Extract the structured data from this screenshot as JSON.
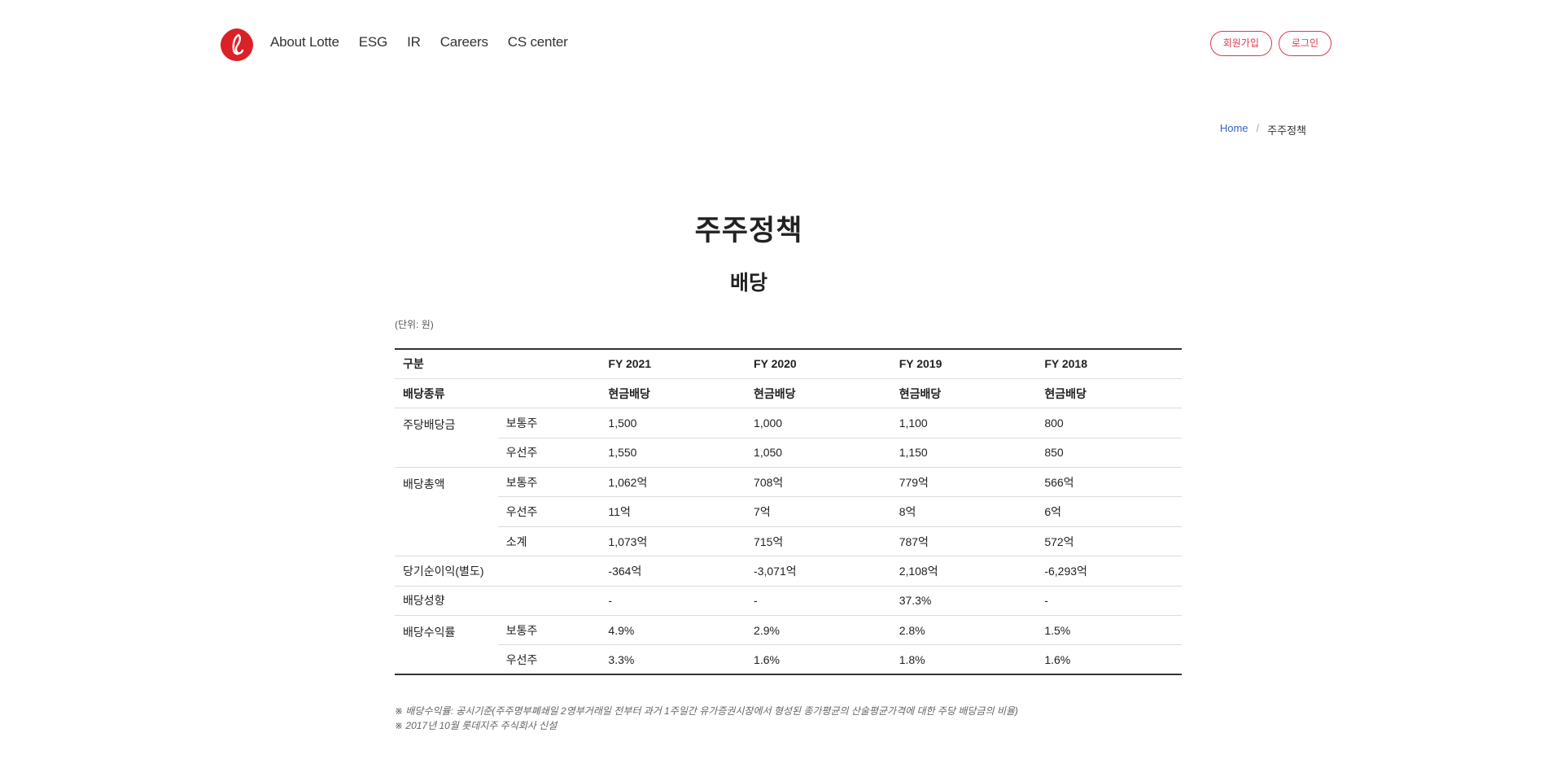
{
  "nav": {
    "items": [
      {
        "label": "About Lotte"
      },
      {
        "label": "ESG"
      },
      {
        "label": "IR"
      },
      {
        "label": "Careers"
      },
      {
        "label": "CS center"
      }
    ],
    "signup": "회원가입",
    "login": "로그인"
  },
  "breadcrumb": {
    "home": "Home",
    "separator": "/",
    "current": "주주정책"
  },
  "page": {
    "title": "주주정책",
    "section": "배당",
    "unit": "(단위: 원)"
  },
  "table": {
    "header": {
      "label": "구분",
      "years": [
        "FY 2021",
        "FY 2020",
        "FY 2019",
        "FY 2018"
      ]
    },
    "type_row": {
      "label": "배당종류",
      "values": [
        "현금배당",
        "현금배당",
        "현금배당",
        "현금배당"
      ]
    },
    "dps": {
      "label": "주당배당금",
      "common": {
        "label": "보통주",
        "values": [
          "1,500",
          "1,000",
          "1,100",
          "800"
        ]
      },
      "preferred": {
        "label": "우선주",
        "values": [
          "1,550",
          "1,050",
          "1,150",
          "850"
        ]
      }
    },
    "total": {
      "label": "배당총액",
      "common": {
        "label": "보통주",
        "values": [
          "1,062억",
          "708억",
          "779억",
          "566억"
        ]
      },
      "preferred": {
        "label": "우선주",
        "values": [
          "11억",
          "7억",
          "8억",
          "6억"
        ]
      },
      "subtotal": {
        "label": "소계",
        "values": [
          "1,073억",
          "715억",
          "787억",
          "572억"
        ]
      }
    },
    "net_income": {
      "label": "당기순이익(별도)",
      "values": [
        "-364억",
        "-3,071억",
        "2,108억",
        "-6,293억"
      ]
    },
    "payout": {
      "label": "배당성향",
      "values": [
        "-",
        "-",
        "37.3%",
        "-"
      ]
    },
    "yield": {
      "label": "배당수익률",
      "common": {
        "label": "보통주",
        "values": [
          "4.9%",
          "2.9%",
          "2.8%",
          "1.5%"
        ]
      },
      "preferred": {
        "label": "우선주",
        "values": [
          "3.3%",
          "1.6%",
          "1.8%",
          "1.6%"
        ]
      }
    }
  },
  "notes": [
    "※ 배당수익률: 공시기준(주주명부폐쇄일 2영부거래일 전부터 과거 1주일간 유가증권시장에서 형성된 종가평균의 산술평균가격에 대한 주당 배당금의 비율)",
    "※ 2017년 10월 롯데지주 주식회사 신설"
  ],
  "colors": {
    "accent": "#e0364c",
    "logo": "#da2128",
    "link": "#3b5fc4"
  }
}
